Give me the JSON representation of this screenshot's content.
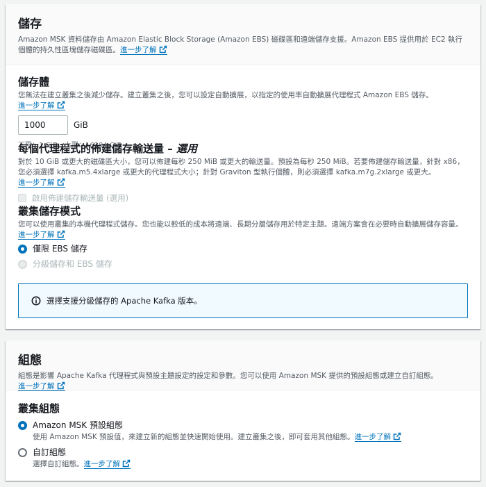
{
  "storage": {
    "title": "儲存",
    "description": "Amazon MSK 資料儲存由 Amazon Elastic Block Storage (Amazon EBS) 磁碟區和遠端儲存支援。Amazon EBS 提供用於 EC2 執行個體的持久性區塊儲存磁碟區。",
    "learn_more": "進一步了解",
    "volume": {
      "label": "儲存體",
      "description": "您無法在建立叢集之後減少儲存。建立叢集之後，您可以設定自動擴展，以指定的使用率自動擴展代理程式 Amazon EBS 儲存。",
      "learn_more": "進一步了解",
      "value": "1000",
      "unit": "GiB",
      "constraint": "下限：1 GiB，上限：16384 GiB"
    },
    "throughput": {
      "label": "每個代理程式的佈建儲存輸送量 – ",
      "label_optional": "選用",
      "description": "對於 10 GiB 或更大的磁碟區大小，您可以佈建每秒 250 MiB 或更大的輸送量。預設為每秒 250 MiB。若要佈建儲存輸送量，針對 x86，您必須選擇 kafka.m5.4xlarge 或更大的代理程式大小；針對 Graviton 型執行個體，則必須選擇 kafka.m7g.2xlarge 或更大。",
      "learn_more": "進一步了解",
      "checkbox_label": "啟用佈建儲存輸送量 (選用)"
    },
    "mode": {
      "label": "叢集儲存模式",
      "description": "您可以使用叢集的本機代理程式儲存。您也能以較低的成本將遠端、長期分層儲存用於特定主題。遠端方案會在必要時自動擴展儲存容量。",
      "learn_more": "進一步了解",
      "options": [
        {
          "label": "僅限 EBS 儲存",
          "checked": true,
          "disabled": false
        },
        {
          "label": "分級儲存和 EBS 儲存",
          "checked": false,
          "disabled": true
        }
      ],
      "info": "選擇支援分級儲存的 Apache Kafka 版本。"
    }
  },
  "configuration": {
    "title": "組態",
    "description": "組態是影響 Apache Kafka 代理程式與預設主題設定的設定和參數。您可以使用 Amazon MSK 提供的預設組態或建立自訂組態。",
    "learn_more": "進一步了解",
    "cluster_config": {
      "label": "叢集組態",
      "options": [
        {
          "label": "Amazon MSK 預設組態",
          "description": "使用 Amazon MSK 預設值，來建立新的組態並快速開始使用。建立叢集之後，即可套用其他組態。",
          "learn_more": "進一步了解",
          "checked": true
        },
        {
          "label": "自訂組態",
          "description": "選擇自訂組態。",
          "learn_more": "進一步了解",
          "checked": false
        }
      ]
    }
  },
  "colors": {
    "link": "#0073bb",
    "info_bg": "#f1faff",
    "text": "#16191f",
    "secondary": "#545b64"
  }
}
